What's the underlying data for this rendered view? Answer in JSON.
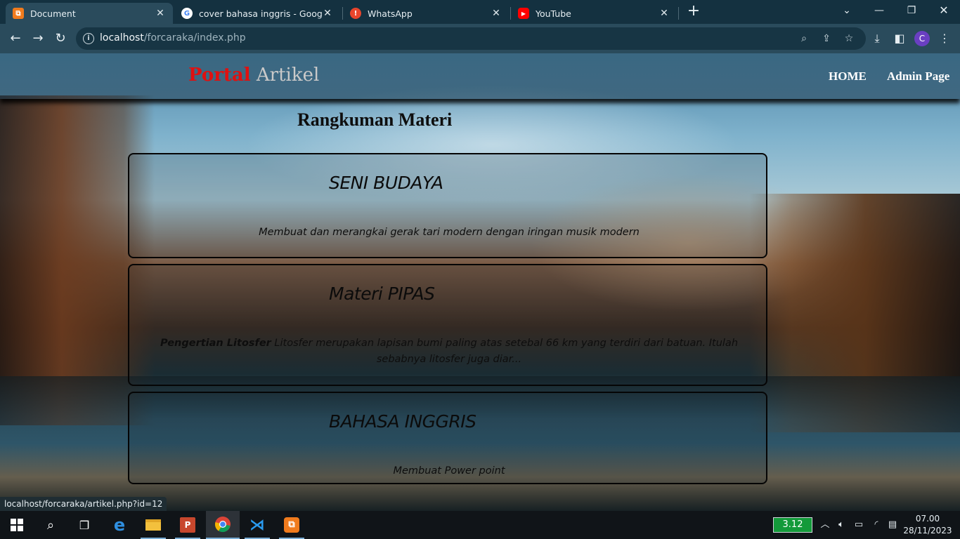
{
  "browser": {
    "tabs": [
      {
        "title": "Document",
        "active": true
      },
      {
        "title": "cover bahasa inggris - Google Pe",
        "active": false
      },
      {
        "title": "WhatsApp",
        "active": false
      },
      {
        "title": "YouTube",
        "active": false
      }
    ],
    "url_host": "localhost",
    "url_path": "/forcaraka/index.php",
    "profile_initial": "C"
  },
  "site": {
    "brand_part1": "Portal",
    "brand_part2": "Artikel",
    "nav": [
      "HOME",
      "Admin Page"
    ],
    "section_title": "Rangkuman Materi",
    "articles": [
      {
        "title": "SENI BUDAYA",
        "lead": "",
        "body": "Membuat dan merangkai gerak tari modern dengan iringan musik modern"
      },
      {
        "title": "Materi PIPAS",
        "lead": "Pengertian Litosfer",
        "body": " Litosfer merupakan lapisan bumi paling atas setebal 66 km yang terdiri dari batuan. Itulah sebabnya litosfer juga diar..."
      },
      {
        "title": "BAHASA INGGRIS",
        "lead": "",
        "body": "Membuat Power point"
      }
    ],
    "status_url": "localhost/forcaraka/artikel.php?id=12"
  },
  "taskbar": {
    "battery": "3.12",
    "time": "07.00",
    "date": "28/11/2023"
  },
  "colors": {
    "brand_red": "#e01010",
    "brand_grey": "#c9c9c9",
    "chrome_dark": "#143140",
    "chrome_toolbar": "#2a4b5c"
  }
}
